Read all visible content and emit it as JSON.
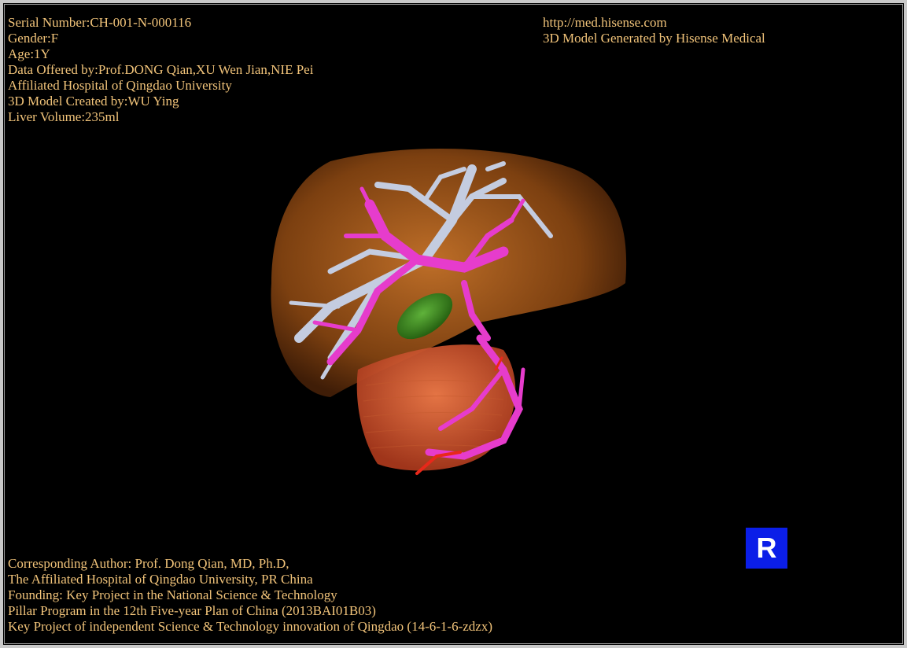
{
  "header_info": [
    "Serial Number:CH-001-N-000116",
    "Gender:F",
    "Age:1Y",
    "Data Offered by:Prof.DONG Qian,XU Wen Jian,NIE Pei",
    "Affiliated Hospital of Qingdao University",
    "3D Model Created by:WU Ying",
    "Liver Volume:235ml"
  ],
  "header_credit": [
    "http://med.hisense.com",
    "3D Model Generated by Hisense Medical"
  ],
  "footer": [
    "Corresponding Author: Prof. Dong Qian, MD, Ph.D,",
    "The Affiliated Hospital of Qingdao University, PR China",
    "Founding: Key Project in the National Science & Technology",
    "Pillar Program in the 12th Five-year Plan of China (2013BAI01B03)",
    "Key Project of independent Science & Technology innovation of Qingdao (14-6-1-6-zdzx)"
  ],
  "orientation_badge": "R",
  "colors": {
    "background": "#000000",
    "text": "#f2c47a",
    "liver": "#b8641e",
    "hepatic_veins": "#c4cce0",
    "portal_vein": "#e63ccc",
    "gallbladder": "#3f8f1f",
    "kidney_vessel": "#e8583a",
    "badge": "#0b1ee8"
  }
}
